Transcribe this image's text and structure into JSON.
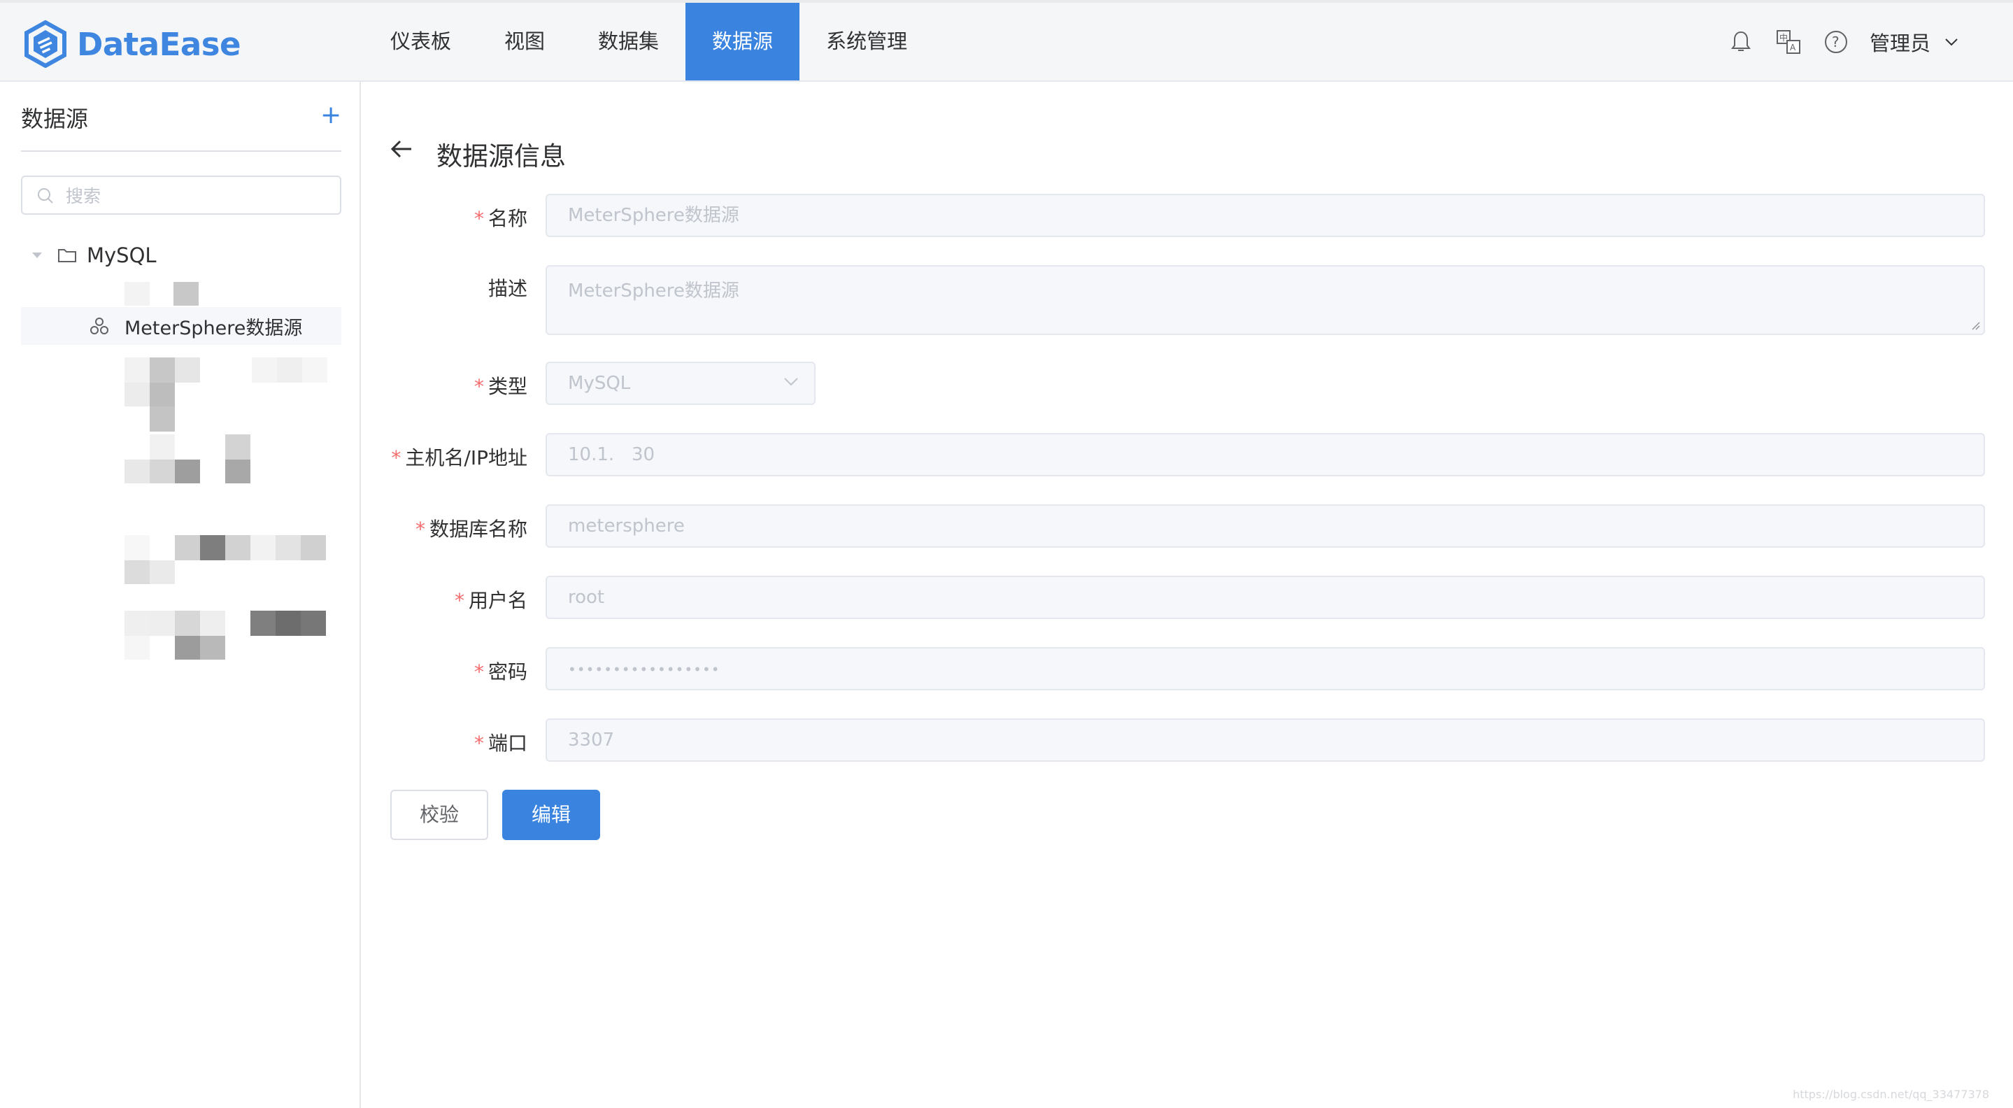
{
  "app": {
    "brand": "DataEase",
    "brand_color": "#3a84e0"
  },
  "nav": {
    "items": [
      {
        "label": "仪表板",
        "active": false
      },
      {
        "label": "视图",
        "active": false
      },
      {
        "label": "数据集",
        "active": false
      },
      {
        "label": "数据源",
        "active": true
      },
      {
        "label": "系统管理",
        "active": false
      }
    ]
  },
  "header": {
    "icons": [
      "bell-icon",
      "translate-icon",
      "help-icon"
    ],
    "user_label": "管理员"
  },
  "sidebar": {
    "title": "数据源",
    "add_symbol": "+",
    "search_placeholder": "搜索",
    "tree": {
      "folder_label": "MySQL",
      "selected_leaf": "MeterSphere数据源"
    }
  },
  "main": {
    "page_title": "数据源信息",
    "form": {
      "name_label": "名称",
      "name_value": "MeterSphere数据源",
      "desc_label": "描述",
      "desc_value": "MeterSphere数据源",
      "type_label": "类型",
      "type_value": "MySQL",
      "host_label": "主机名/IP地址",
      "host_value": "10.1.   30",
      "db_label": "数据库名称",
      "db_value": "metersphere",
      "user_label": "用户名",
      "user_value": "root",
      "password_label": "密码",
      "password_value": "•••••••••••••••••",
      "port_label": "端口",
      "port_value": "3307",
      "required_mark": "*"
    },
    "buttons": {
      "validate": "校验",
      "edit": "编辑"
    }
  },
  "footer": {
    "watermark": "https://blog.csdn.net/qq_33477378"
  }
}
